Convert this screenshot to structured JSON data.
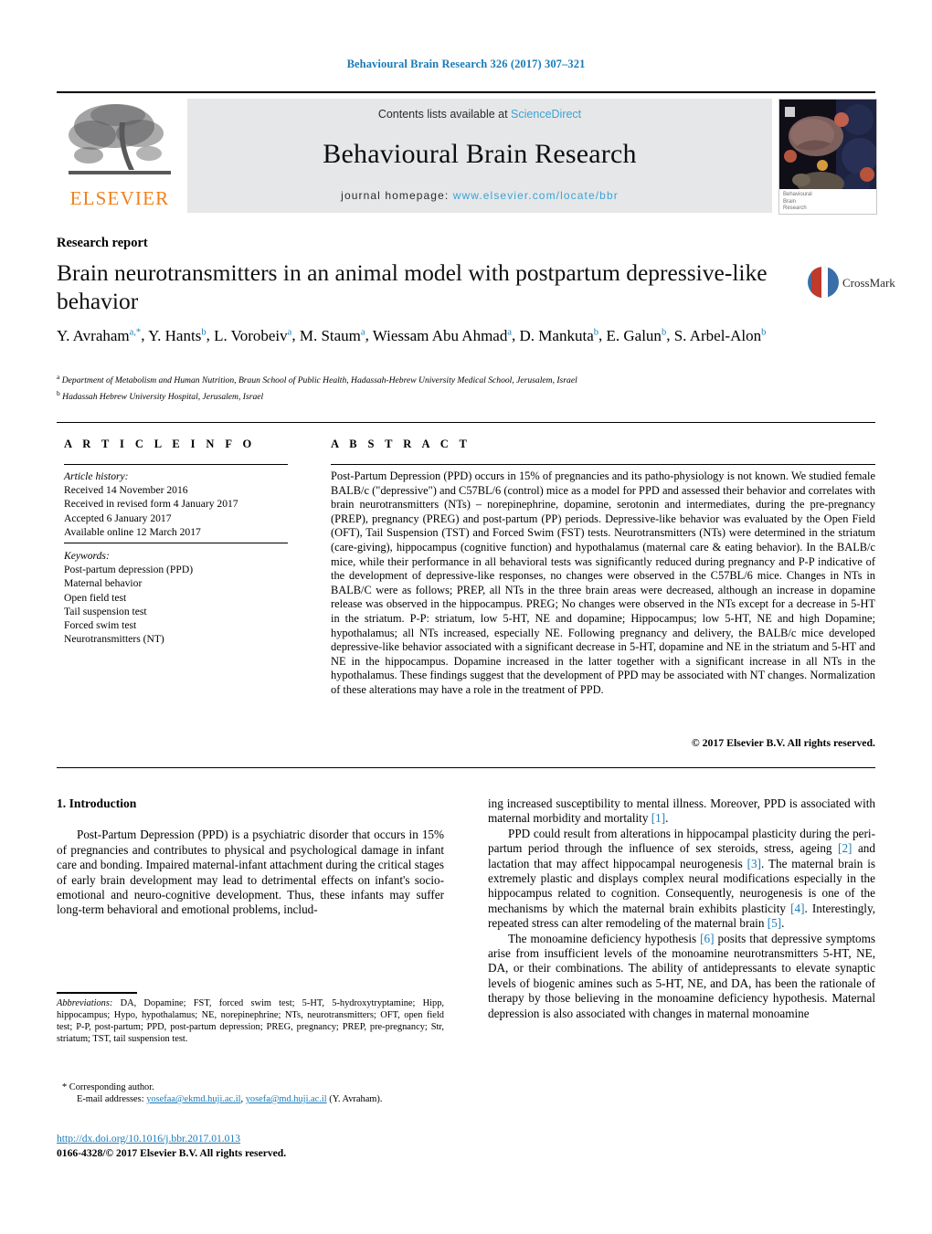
{
  "running_head": "Behavioural Brain Research 326 (2017) 307–321",
  "masthead": {
    "publisher_logo_label": "ELSEVIER",
    "contents_prefix": "Contents lists available at ",
    "contents_link": "ScienceDirect",
    "journal_title": "Behavioural Brain Research",
    "homepage_prefix": "journal homepage: ",
    "homepage_url": "www.elsevier.com/locate/bbr",
    "cover_caption_line1": "Behavioural",
    "cover_caption_line2": "Brain",
    "cover_caption_line3": "Research",
    "link_color": "#3ba3d6",
    "band_color": "#e6e7e8",
    "elsevier_orange": "#f08019"
  },
  "article": {
    "type_label": "Research report",
    "title": "Brain neurotransmitters in an animal model with postpartum depressive-like behavior",
    "crossmark_label": "CrossMark",
    "authors": [
      {
        "name": "Y. Avraham",
        "marks": "a,*"
      },
      {
        "name": "Y. Hants",
        "marks": "b"
      },
      {
        "name": "L. Vorobeiv",
        "marks": "a"
      },
      {
        "name": "M. Staum",
        "marks": "a"
      },
      {
        "name": "Wiessam Abu Ahmad",
        "marks": "a"
      },
      {
        "name": "D. Mankuta",
        "marks": "b"
      },
      {
        "name": "E. Galun",
        "marks": "b"
      },
      {
        "name": "S. Arbel-Alon",
        "marks": "b"
      }
    ],
    "affiliations": [
      {
        "mark": "a",
        "text": "Department of Metabolism and Human Nutrition, Braun School of Public Health, Hadassah-Hebrew University Medical School, Jerusalem, Israel"
      },
      {
        "mark": "b",
        "text": "Hadassah Hebrew University Hospital, Jerusalem, Israel"
      }
    ]
  },
  "article_info": {
    "heading": "A R T I C L E   I N F O",
    "history_label": "Article history:",
    "history": [
      "Received 14 November 2016",
      "Received in revised form 4 January 2017",
      "Accepted 6 January 2017",
      "Available online 12 March 2017"
    ],
    "keywords_label": "Keywords:",
    "keywords": [
      "Post-partum depression (PPD)",
      "Maternal behavior",
      "Open field test",
      "Tail suspension test",
      "Forced swim test",
      "Neurotransmitters (NT)"
    ]
  },
  "abstract": {
    "heading": "A B S T R A C T",
    "text": "Post-Partum Depression (PPD) occurs in 15% of pregnancies and its patho-physiology is not known. We studied female BALB/c (\"depressive\") and C57BL/6 (control) mice as a model for PPD and assessed their behavior and correlates with brain neurotransmitters (NTs) – norepinephrine, dopamine, serotonin and intermediates, during the pre-pregnancy (PREP), pregnancy (PREG) and post-partum (PP) periods. Depressive-like behavior was evaluated by the Open Field (OFT), Tail Suspension (TST) and Forced Swim (FST) tests. Neurotransmitters (NTs) were determined in the striatum (care-giving), hippocampus (cognitive function) and hypothalamus (maternal care & eating behavior). In the BALB/c mice, while their performance in all behavioral tests was significantly reduced during pregnancy and P-P indicative of the development of depressive-like responses, no changes were observed in the C57BL/6 mice. Changes in NTs in BALB/C were as follows; PREP, all NTs in the three brain areas were decreased, although an increase in dopamine release was observed in the hippocampus. PREG; No changes were observed in the NTs except for a decrease in 5-HT in the striatum. P-P: striatum, low 5-HT, NE and dopamine; Hippocampus; low 5-HT, NE and high Dopamine; hypothalamus; all NTs increased, especially NE. Following pregnancy and delivery, the BALB/c mice developed depressive-like behavior associated with a significant decrease in 5-HT, dopamine and NE in the striatum and 5-HT and NE in the hippocampus. Dopamine increased in the latter together with a significant increase in all NTs in the hypothalamus. These findings suggest that the development of PPD may be associated with NT changes. Normalization of these alterations may have a role in the treatment of PPD.",
    "copyright": "© 2017 Elsevier B.V. All rights reserved."
  },
  "body": {
    "section_number_title": "1. Introduction",
    "left_paragraph_1": "Post-Partum Depression (PPD) is a psychiatric disorder that occurs in 15% of pregnancies and contributes to physical and psychological damage in infant care and bonding. Impaired maternal-infant attachment during the critical stages of early brain development may lead to detrimental effects on infant's socio-emotional and neuro-cognitive development. Thus, these infants may suffer long-term behavioral and emotional problems, includ-",
    "right_paragraph_1_cont": "ing increased susceptibility to mental illness. Moreover, PPD is associated with maternal morbidity and mortality ",
    "right_paragraph_1_ref": "[1]",
    "right_paragraph_2_a": "PPD could result from alterations in hippocampal plasticity during the peri-partum period through the influence of sex steroids, stress, ageing ",
    "right_paragraph_2_ref1": "[2]",
    "right_paragraph_2_b": " and lactation that may affect hippocampal neurogenesis ",
    "right_paragraph_2_ref2": "[3]",
    "right_paragraph_2_c": ". The maternal brain is extremely plastic and displays complex neural modifications especially in the hippocampus related to cognition. Consequently, neurogenesis is one of the mechanisms by which the maternal brain exhibits plasticity ",
    "right_paragraph_2_ref3": "[4]",
    "right_paragraph_2_d": ". Interestingly, repeated stress can alter remodeling of the maternal brain ",
    "right_paragraph_2_ref4": "[5]",
    "right_paragraph_2_e": ".",
    "right_paragraph_3_a": "The monoamine deficiency hypothesis ",
    "right_paragraph_3_ref1": "[6]",
    "right_paragraph_3_b": " posits that depressive symptoms arise from insufficient levels of the monoamine neurotransmitters 5-HT, NE, DA, or their combinations. The ability of antidepressants to elevate synaptic levels of biogenic amines such as 5-HT, NE, and DA, has been the rationale of therapy by those believing in the monoamine deficiency hypothesis. Maternal depression is also associated with changes in maternal monoamine"
  },
  "footnotes": {
    "abbrev_label": "Abbreviations:",
    "abbrev_text": " DA, Dopamine; FST, forced swim test; 5-HT, 5-hydroxytryptamine; Hipp, hippocampus; Hypo, hypothalamus; NE, norepinephrine; NTs, neurotransmitters; OFT, open field test; P-P, post-partum; PPD, post-partum depression; PREG, pregnancy; PREP, pre-pregnancy; Str, striatum; TST, tail suspension test.",
    "corresponding": "* Corresponding author.",
    "email_label": "E-mail addresses:",
    "email_1": "yosefaa@ekmd.huji.ac.il",
    "email_2": "yosefa@md.huji.ac.il",
    "email_attrib": " (Y. Avraham).",
    "doi": "http://dx.doi.org/10.1016/j.bbr.2017.01.013",
    "issn_line": "0166-4328/© 2017 Elsevier B.V. All rights reserved."
  }
}
